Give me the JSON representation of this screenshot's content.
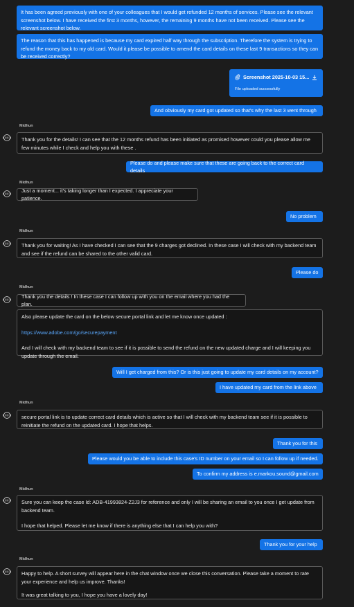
{
  "chat": {
    "agent_name": "Midhun",
    "messages": [
      {
        "from": "user",
        "paragraphs": [
          "It has been agreed previously with one of your colleagues that I would get refunded 12 months of services. Please see the relevant screenshot below. I have received the first 3 months, however, the remaining 9 months have not been received. Please see the relevant screenshot below."
        ]
      },
      {
        "from": "user",
        "paragraphs": [
          "The reason that this has happened is because my card expired half way through the subscription. Therefore the system is trying to refund the money back to my old card. Would it please be possible to amend the card details on these last 9 transactions so they can be received correctly?"
        ]
      },
      {
        "from": "user",
        "type": "file",
        "file_name": "Screenshot 2025-10-03 15...",
        "status": "File uploaded successfully"
      },
      {
        "from": "user",
        "text": "And obviously my card got updated so that's why the last 3 went through"
      },
      {
        "from": "agent",
        "text": "Thank you for the details! I can see that the 12 months refund has been initiated as promised however could you please allow me few minutes while I check and help you with these ."
      },
      {
        "from": "user",
        "text": "Please do and please make sure that these are going back to the correct card details"
      },
      {
        "from": "agent",
        "text": "Just a moment... it's taking longer than I expected. I appreciate your patience."
      },
      {
        "from": "user",
        "text": "No problem"
      },
      {
        "from": "agent",
        "text": "Thank you for waiting! As I have checked I can see that the 9 charges got declined. In these case I will check with my backend team and see if the refund can be shared to the other valid card."
      },
      {
        "from": "user",
        "text": "Please do"
      },
      {
        "from": "agent",
        "text": "Thank you the details ! In these case I can follow up with you on the email where you had the plan."
      },
      {
        "from": "agent",
        "line1": "Also please update the card on the below secure portal link and let me know once updated :",
        "link": "https://www.adobe.com/go/securepayment",
        "line2": "And I will check with my backend team to see if it is possible to send the refund on the new updated charge and I will keeping you update through the email."
      },
      {
        "from": "user",
        "text": "Will I get charged from this? Or is this just going to update my card details on my account?"
      },
      {
        "from": "user",
        "text": "I have updated my card from the link above"
      },
      {
        "from": "agent",
        "text": "secure portal link is to update correct card details which is active so that I will check with my backend team see if it is possible to reinitiate the refund on the updated card. I hope that helps."
      },
      {
        "from": "user",
        "text": "Thank you for this"
      },
      {
        "from": "user",
        "text": "Please would you be able to include this case's ID number on your email so I can follow up if needed."
      },
      {
        "from": "user",
        "text": "To confirm my address is e.markou.sound@gmail.com"
      },
      {
        "from": "agent",
        "line1": "Sure you can keep the case Id: ADB-41993824-Z2J3 for reference and only I will be sharing an email to you once I get update from backend team.",
        "line2": "I hope that helped. Please let me know if there is anything else that I can help you with?"
      },
      {
        "from": "user",
        "text": "Thank you for your help"
      },
      {
        "from": "agent",
        "line1": "Happy to help. A short survey will appear here in the chat window once we close this conversation. Please take a moment to rate your experience and help us improve. Thanks!",
        "line2": "It was great talking to you, I hope you have a lovely day!"
      }
    ]
  },
  "colors": {
    "background": "#1c1c1c",
    "user_bubble": "#1473e6",
    "agent_border": "#5a5a5a",
    "link": "#5aa9ff"
  },
  "icons": {
    "agent_avatar": "robot-head-icon",
    "attachment": "paperclip-icon",
    "download": "download-icon"
  }
}
